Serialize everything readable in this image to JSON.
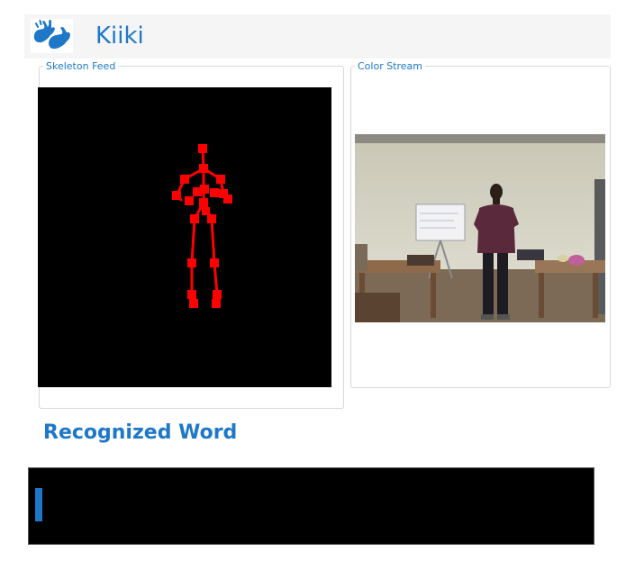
{
  "app": {
    "title": "Kiiki",
    "logo_icon": "sign-language-hands-icon",
    "accent_color": "#1e78c8"
  },
  "skeleton_panel": {
    "label": "Skeleton Feed",
    "joint_color": "#ff0000",
    "background": "#000000"
  },
  "color_panel": {
    "label": "Color Stream"
  },
  "recognized": {
    "title": "Recognized Word",
    "word": ""
  }
}
